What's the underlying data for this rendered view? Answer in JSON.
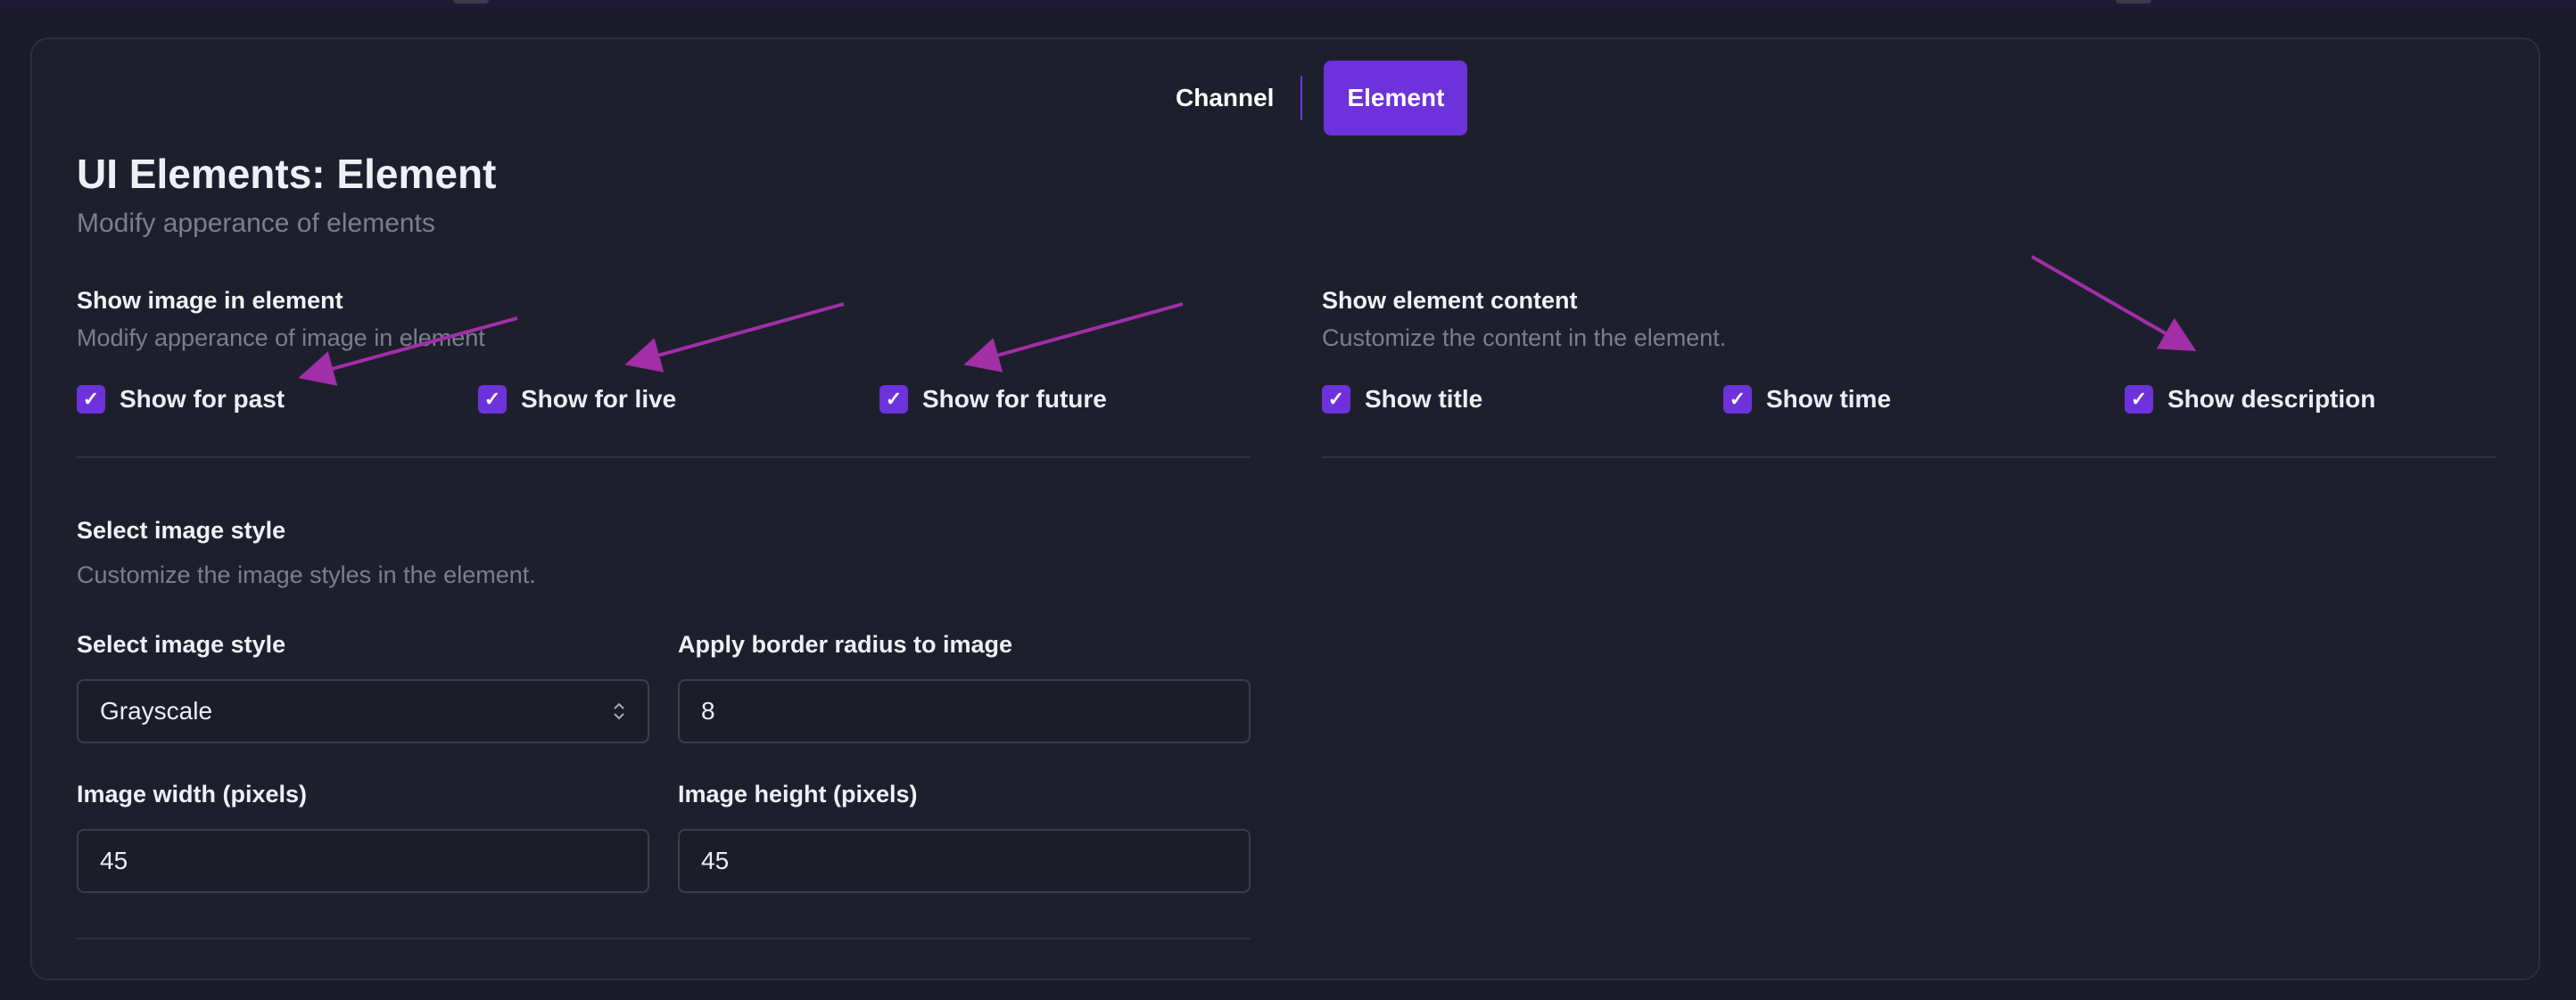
{
  "tabs": [
    {
      "label": "Channel"
    },
    {
      "label": "Element"
    }
  ],
  "header": {
    "title": "UI Elements: Element",
    "subtitle": "Modify apperance of elements"
  },
  "image_section": {
    "title": "Show image in element",
    "subtitle": "Modify apperance of image in element",
    "checkboxes": [
      {
        "label": "Show for past",
        "checked": true
      },
      {
        "label": "Show for live",
        "checked": true
      },
      {
        "label": "Show for future",
        "checked": true
      }
    ]
  },
  "content_section": {
    "title": "Show element content",
    "subtitle": "Customize the content in the element.",
    "checkboxes": [
      {
        "label": "Show title",
        "checked": true
      },
      {
        "label": "Show time",
        "checked": true
      },
      {
        "label": "Show description",
        "checked": true
      }
    ]
  },
  "style_section": {
    "title": "Select image style",
    "subtitle": "Customize the image styles in the element.",
    "image_style": {
      "label": "Select image style",
      "value": "Grayscale"
    },
    "border_radius": {
      "label": "Apply border radius to image",
      "value": "8"
    },
    "width": {
      "label": "Image width (pixels)",
      "value": "45"
    },
    "height": {
      "label": "Image height (pixels)",
      "value": "45"
    }
  },
  "icons": {
    "check": "✓",
    "select_chevron": "⌃⌄"
  },
  "colors": {
    "accent": "#6d32db",
    "annotation_arrow": "#a22ea8",
    "background": "#1a1c29",
    "panel": "#1d202c"
  }
}
